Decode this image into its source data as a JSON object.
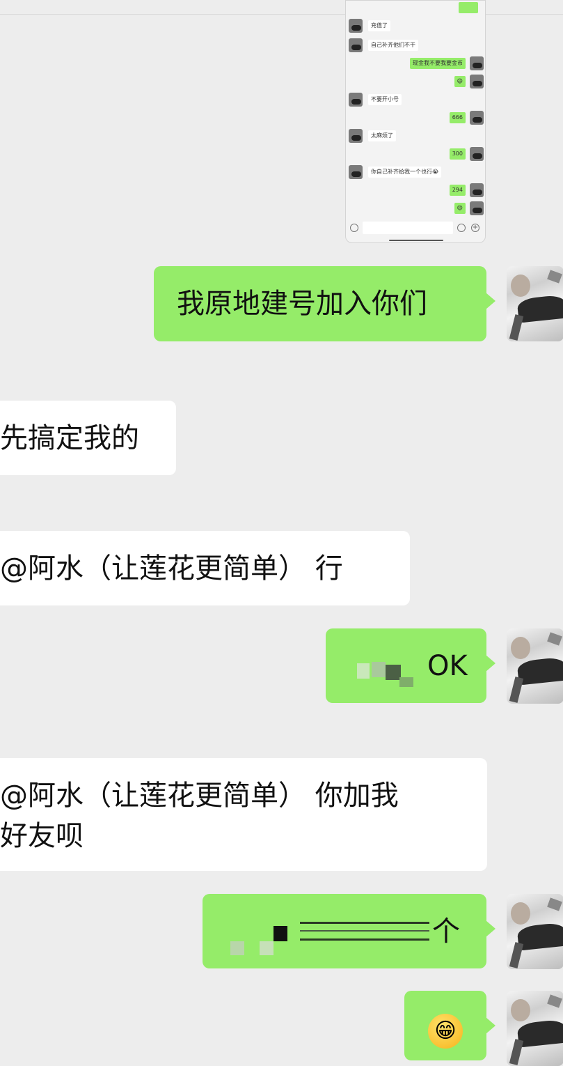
{
  "embedded_screenshot": {
    "messages": [
      {
        "side": "left",
        "text": "充值了"
      },
      {
        "side": "left",
        "text": "自己补齐他们不干"
      },
      {
        "side": "right",
        "text": "现金我不要我要金币"
      },
      {
        "side": "right",
        "text": "😄"
      },
      {
        "side": "left",
        "text": "不要开小号"
      },
      {
        "side": "right",
        "text": "666"
      },
      {
        "side": "left",
        "text": "太麻烦了"
      },
      {
        "side": "right",
        "text": "300"
      },
      {
        "side": "left",
        "text": "你自己补齐给我一个也行😭"
      },
      {
        "side": "right",
        "text": "294"
      },
      {
        "side": "right",
        "text": "😄"
      }
    ]
  },
  "messages": [
    {
      "side": "right",
      "text": "我原地建号加入你们"
    },
    {
      "side": "left",
      "text": "先搞定我的"
    },
    {
      "side": "left",
      "text": "@阿水（让莲花更简单） 行"
    },
    {
      "side": "right",
      "text": "OK"
    },
    {
      "side": "left",
      "line1": "@阿水（让莲花更简单） 你加我",
      "line2": "好友呗"
    },
    {
      "side": "right",
      "text": "个"
    },
    {
      "side": "right",
      "text": "😁"
    }
  ],
  "colors": {
    "background": "#ededed",
    "self_bubble": "#95ec69",
    "other_bubble": "#ffffff"
  },
  "icons": [
    "avatar",
    "voice-icon",
    "emoji-icon",
    "plus-icon",
    "grin-emoji"
  ]
}
